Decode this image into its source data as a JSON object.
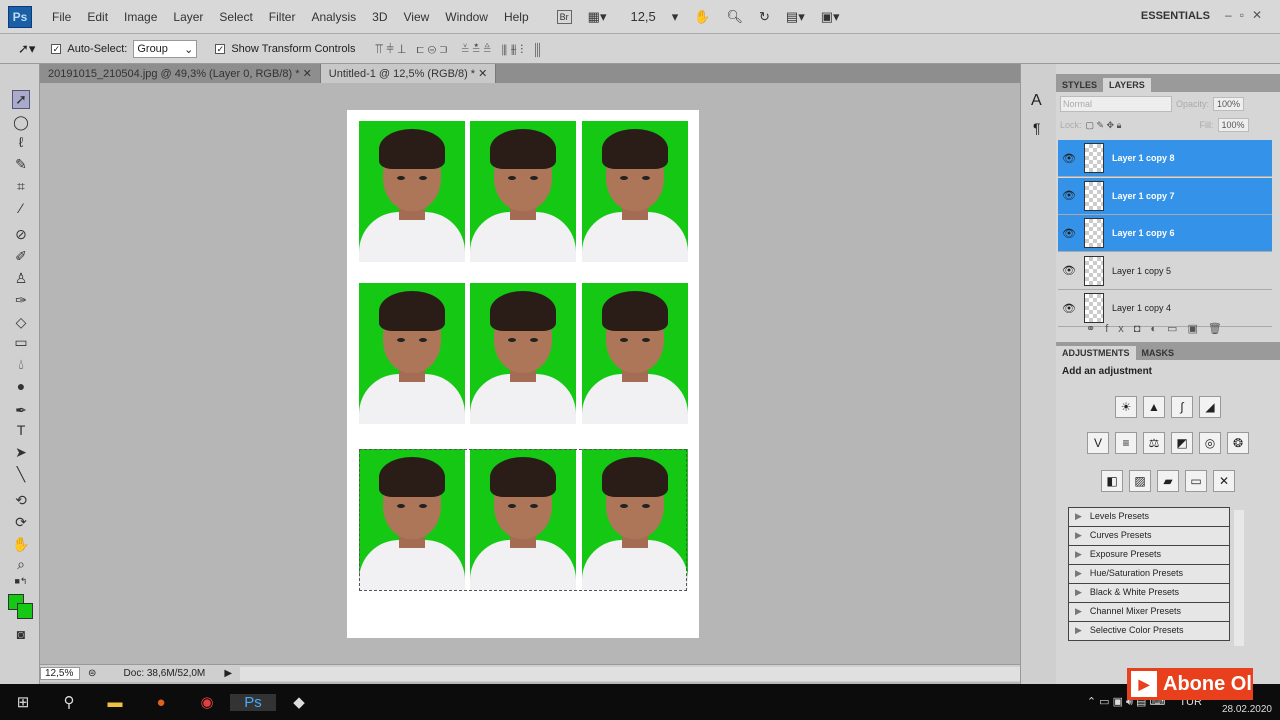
{
  "menu": [
    "File",
    "Edit",
    "Image",
    "Layer",
    "Select",
    "Filter",
    "Analysis",
    "3D",
    "View",
    "Window",
    "Help"
  ],
  "app_logo": "Ps",
  "bridge": "Br",
  "zoom_select": "12,5",
  "workspace": "ESSENTIALS",
  "options": {
    "auto_select": "Auto-Select:",
    "auto_select_value": "Group",
    "show_transform": "Show Transform Controls"
  },
  "tabs": [
    "20191015_210504.jpg @ 49,3% (Layer 0, RGB/8) *",
    "Untitled-1 @ 12,5% (RGB/8) *"
  ],
  "status": {
    "zoom": "12,5%",
    "doc": "Doc: 38,6M/52,0M"
  },
  "layers_panel": {
    "tabs": [
      "STYLES",
      "LAYERS"
    ],
    "blend": "Normal",
    "opacity_label": "Opacity:",
    "opacity": "100%",
    "lock_label": "Lock:",
    "fill_label": "Fill:",
    "fill": "100%",
    "layers": [
      {
        "name": "Layer 1 copy 8",
        "selected": true
      },
      {
        "name": "Layer 1 copy 7",
        "selected": true
      },
      {
        "name": "Layer 1 copy 6",
        "selected": true
      },
      {
        "name": "Layer 1 copy 5",
        "selected": false
      },
      {
        "name": "Layer 1 copy 4",
        "selected": false
      }
    ]
  },
  "adjustments": {
    "tabs": [
      "ADJUSTMENTS",
      "MASKS"
    ],
    "title": "Add an adjustment",
    "presets": [
      "Levels Presets",
      "Curves Presets",
      "Exposure Presets",
      "Hue/Saturation Presets",
      "Black & White Presets",
      "Channel Mixer Presets",
      "Selective Color Presets"
    ]
  },
  "taskbar": {
    "lang": "TUR",
    "date": "28.02.2020"
  },
  "overlay": {
    "subscribe": "Abone Ol"
  }
}
